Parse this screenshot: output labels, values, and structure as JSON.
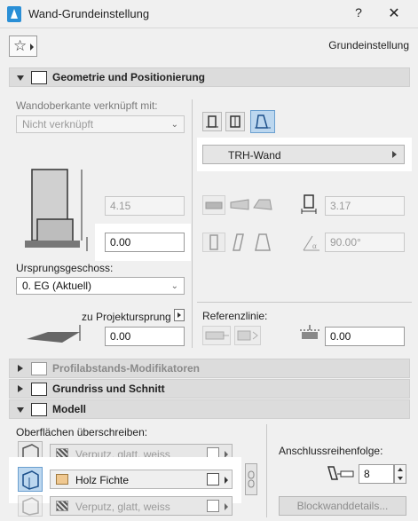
{
  "window": {
    "title": "Wand-Grundeinstellung",
    "help_label": "?",
    "close_label": "✕"
  },
  "header": {
    "preset_label": "Grundeinstellung",
    "favorites_icon": "star-icon"
  },
  "sections": {
    "geometry": {
      "label": "Geometrie und Positionierung",
      "expanded": true
    },
    "profile_mods": {
      "label": "Profilabstands-Modifikatoren",
      "expanded": false
    },
    "floorplan": {
      "label": "Grundriss und Schnitt",
      "expanded": false
    },
    "model": {
      "label": "Modell",
      "expanded": true
    }
  },
  "geometry": {
    "top_link_label": "Wandoberkante verknüpft mit:",
    "top_link_value": "Nicht verknüpft",
    "height_value": "4.15",
    "base_offset_value": "0.00",
    "home_story_label": "Ursprungsgeschoss:",
    "home_story_value": "0. EG (Aktuell)",
    "to_project_zero_label": "zu Projektursprung",
    "to_project_zero_value": "0.00",
    "structure_profile_value": "TRH-Wand",
    "thickness_value": "3.17",
    "angle_value": "90.00°",
    "reference_line_label": "Referenzlinie:",
    "reference_offset_value": "0.00"
  },
  "model": {
    "override_label": "Oberflächen überschreiben:",
    "materials": [
      {
        "label": "Verputz, glatt, weiss",
        "active": false,
        "color": "#9a9a9a"
      },
      {
        "label": "Holz Fichte",
        "active": true,
        "color": "#f0c890"
      },
      {
        "label": "Verputz, glatt, weiss",
        "active": false,
        "color": "#9a9a9a"
      }
    ],
    "connection_order_label": "Anschlussreihenfolge:",
    "connection_order_value": "8",
    "block_details_label": "Blockwanddetails..."
  }
}
